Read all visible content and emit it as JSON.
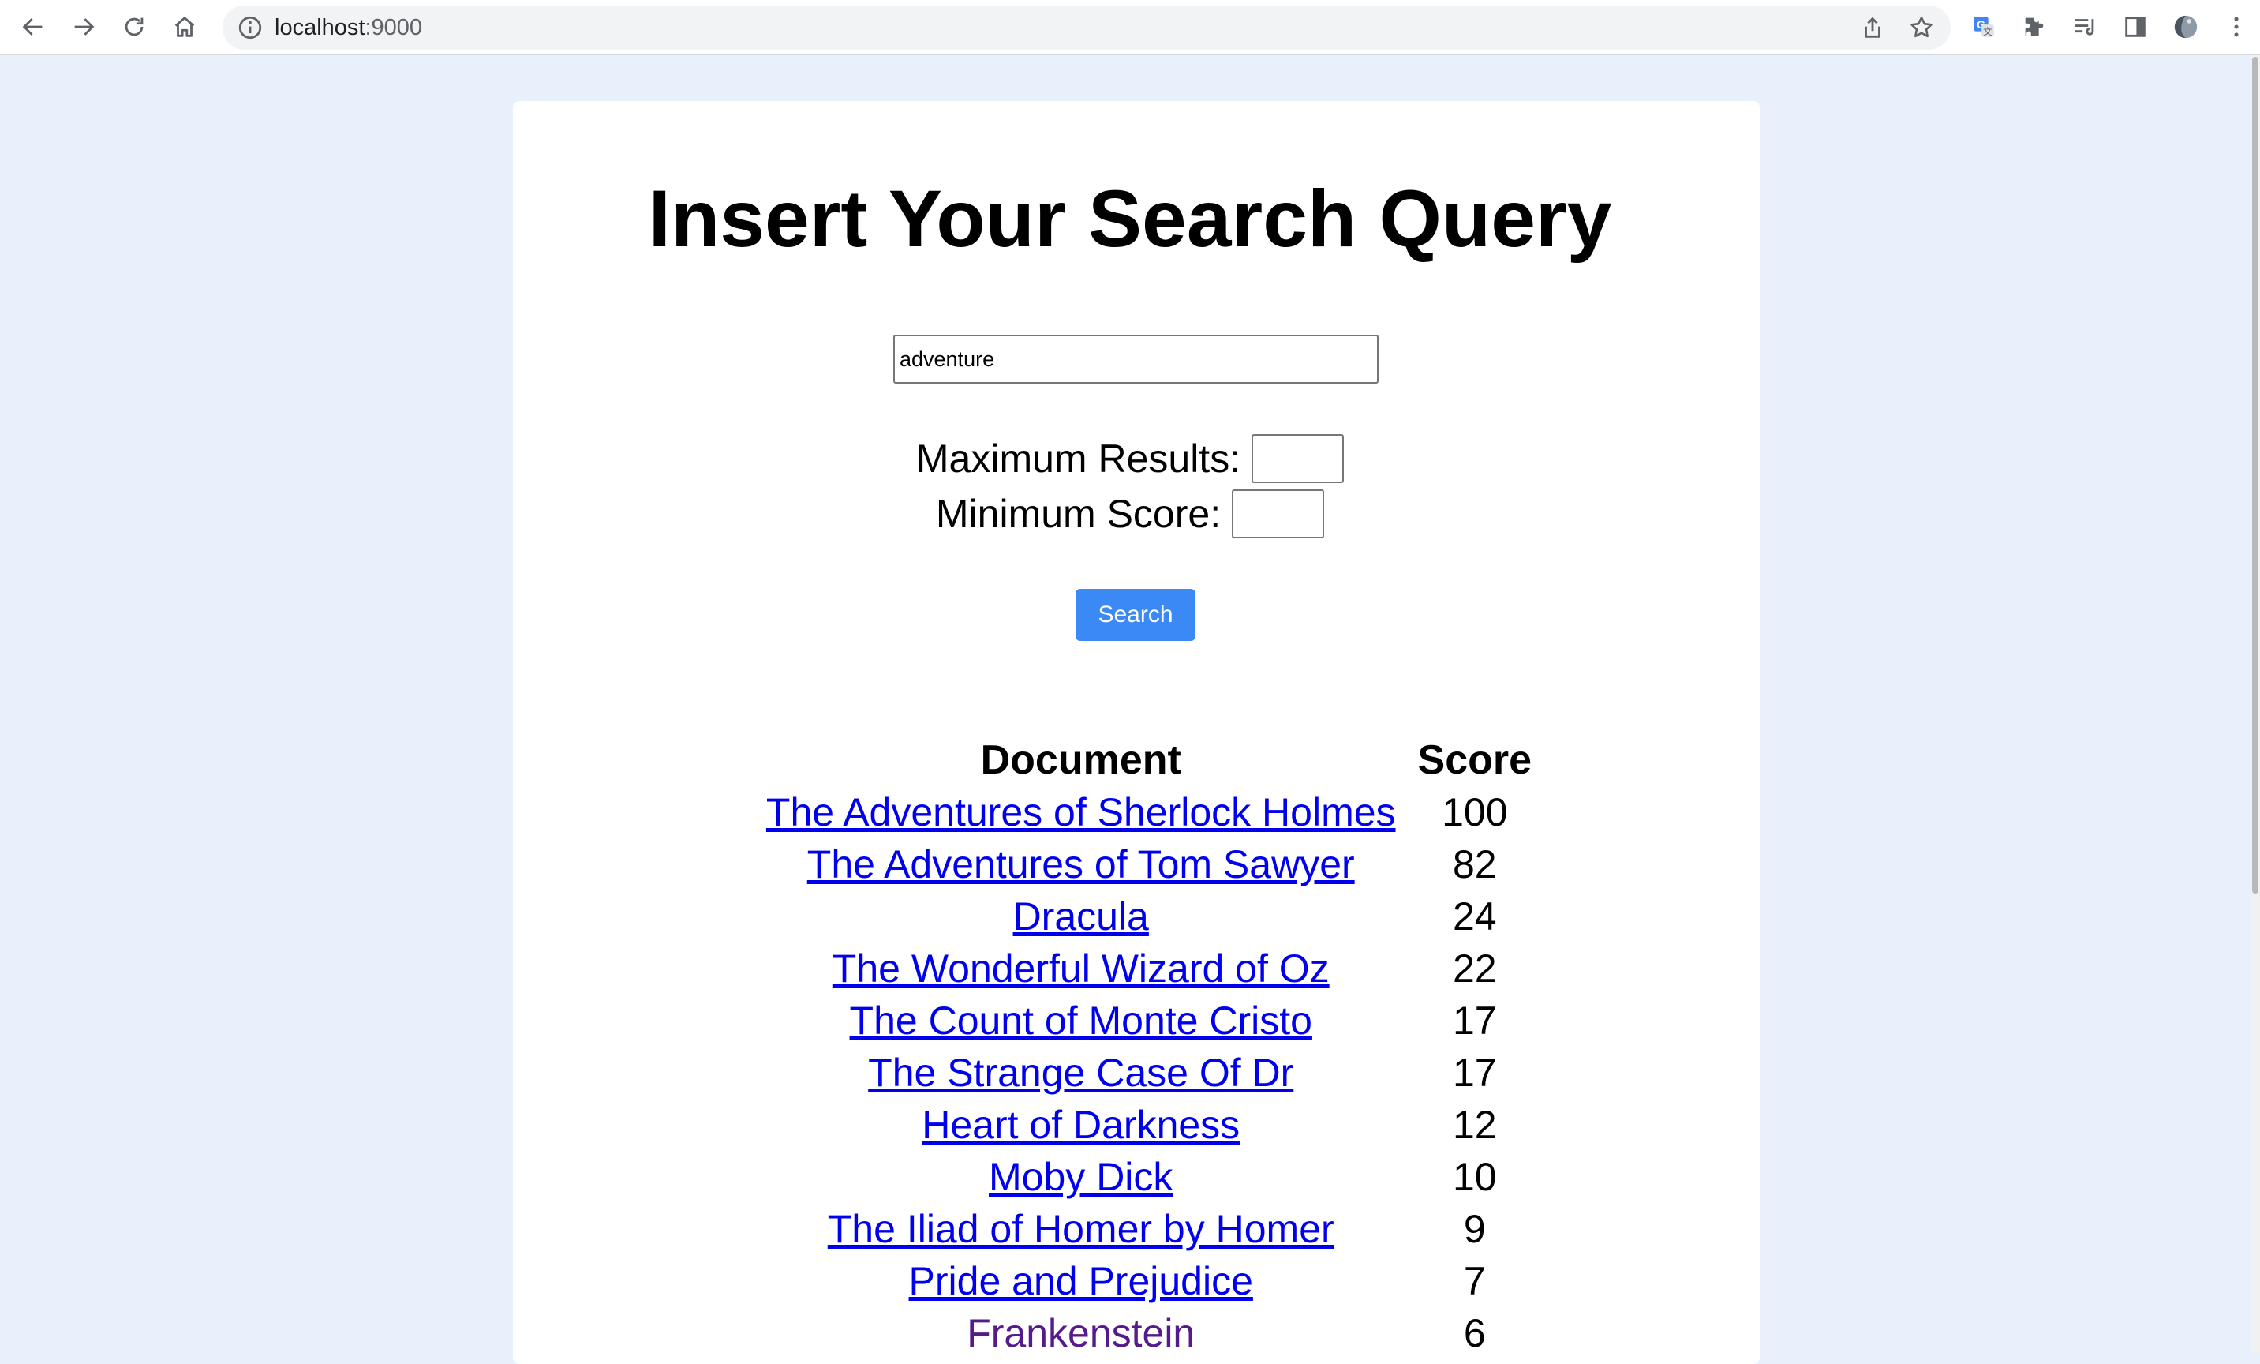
{
  "browser": {
    "url_host": "localhost",
    "url_port": ":9000",
    "icons": [
      "back-icon",
      "forward-icon",
      "reload-icon",
      "home-icon",
      "site-info-icon",
      "share-icon",
      "bookmark-star-icon",
      "translate-icon",
      "extensions-icon",
      "reading-list-icon",
      "side-panel-icon",
      "profile-avatar-icon",
      "menu-kebab-icon"
    ]
  },
  "page": {
    "title": "Insert Your Search Query",
    "search": {
      "value": "adventure",
      "placeholder": ""
    },
    "max_results_label": "Maximum Results:",
    "max_results_value": "",
    "min_score_label": "Minimum Score:",
    "min_score_value": "",
    "search_button_label": "Search"
  },
  "results": {
    "columns": [
      "Document",
      "Score"
    ],
    "rows": [
      {
        "document": "The Adventures of Sherlock Holmes",
        "score": "100",
        "visited": false
      },
      {
        "document": "The Adventures of Tom Sawyer",
        "score": "82",
        "visited": false
      },
      {
        "document": "Dracula",
        "score": "24",
        "visited": false
      },
      {
        "document": "The Wonderful Wizard of Oz",
        "score": "22",
        "visited": false
      },
      {
        "document": "The Count of Monte Cristo",
        "score": "17",
        "visited": false
      },
      {
        "document": "The Strange Case Of Dr",
        "score": "17",
        "visited": false
      },
      {
        "document": "Heart of Darkness",
        "score": "12",
        "visited": false
      },
      {
        "document": "Moby Dick",
        "score": "10",
        "visited": false
      },
      {
        "document": "The Iliad of Homer by Homer",
        "score": "9",
        "visited": false
      },
      {
        "document": "Pride and Prejudice",
        "score": "7",
        "visited": false
      },
      {
        "document": "Frankenstein",
        "score": "6",
        "visited": true
      }
    ]
  },
  "colors": {
    "page_background": "#e8f1fb",
    "link": "#0000ee",
    "visited_link": "#551a8b",
    "button": "#3b89f4"
  }
}
